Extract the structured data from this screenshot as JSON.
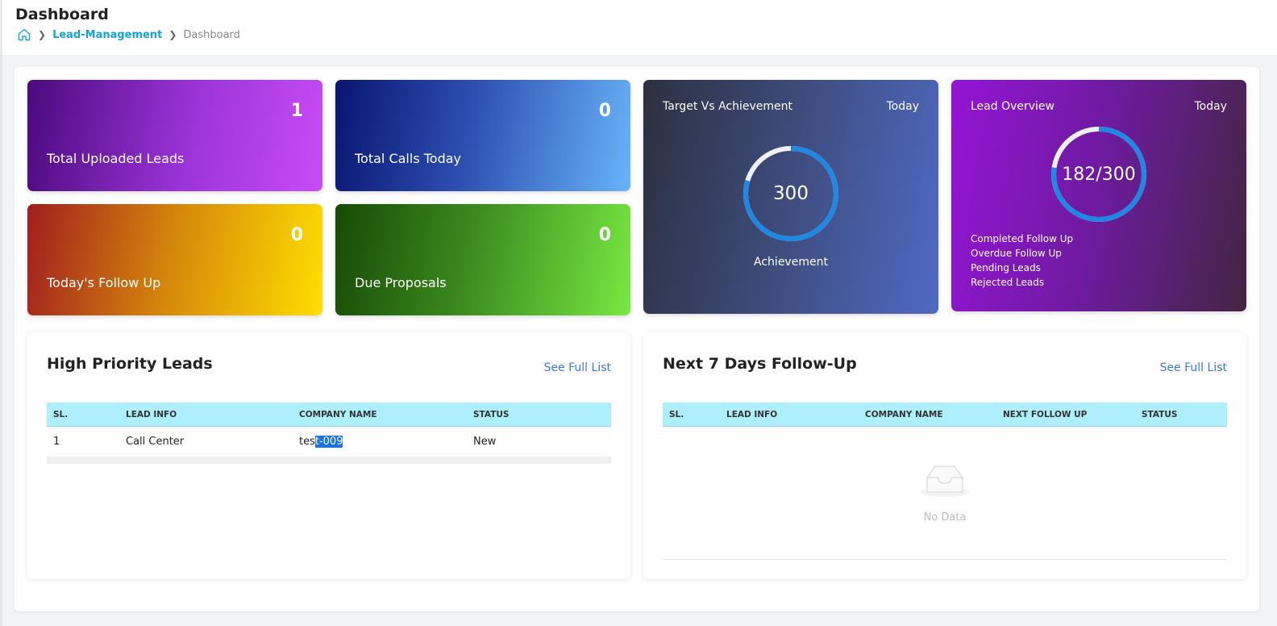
{
  "header": {
    "title": "Dashboard",
    "breadcrumb": {
      "link": "Lead-Management",
      "current": "Dashboard"
    }
  },
  "stats": [
    {
      "label": "Total Uploaded Leads",
      "value": "1"
    },
    {
      "label": "Total Calls Today",
      "value": "0"
    },
    {
      "label": "Today's Follow Up",
      "value": "0"
    },
    {
      "label": "Due Proposals",
      "value": "0"
    }
  ],
  "target": {
    "title": "Target Vs Achievement",
    "period": "Today",
    "value": "300",
    "caption": "Achievement"
  },
  "overview": {
    "title": "Lead Overview",
    "period": "Today",
    "value": "182/300",
    "legend": [
      "Completed Follow Up",
      "Overdue Follow Up",
      "Pending Leads",
      "Rejected Leads"
    ]
  },
  "high_priority": {
    "title": "High Priority Leads",
    "link": "See Full List",
    "columns": [
      "SL.",
      "LEAD INFO",
      "COMPANY NAME",
      "STATUS"
    ],
    "rows": [
      {
        "sl": "1",
        "lead_info": "Call Center",
        "company_pre": "tes",
        "company_sel": "t-009",
        "status": "New"
      }
    ]
  },
  "followup": {
    "title": "Next 7 Days Follow-Up",
    "link": "See Full List",
    "columns": [
      "SL.",
      "LEAD INFO",
      "COMPANY NAME",
      "NEXT FOLLOW UP",
      "STATUS"
    ],
    "empty_text": "No Data"
  },
  "colors": {
    "accent_link": "#12a4d8",
    "table_header": "#aeeffd",
    "ring_blue": "#1e88e5"
  }
}
